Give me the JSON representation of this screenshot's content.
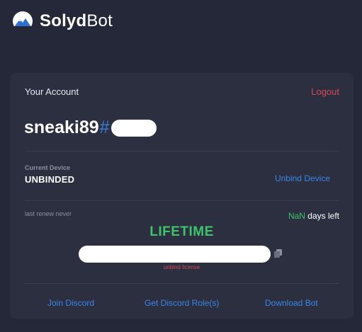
{
  "header": {
    "brand_bold": "Solyd",
    "brand_regular": "Bot",
    "logo_icon": "mountain-logo-icon"
  },
  "account": {
    "label": "Your Account",
    "logout": "Logout",
    "username": "sneaki89",
    "discriminator_prefix": "#"
  },
  "device": {
    "label": "Current Device",
    "value": "UNBINDED",
    "unbind": "Unbind Device"
  },
  "license": {
    "last_renew": "last renew never",
    "days_value": "NaN",
    "days_suffix": "days left",
    "type": "LIFETIME",
    "unbind": "unbind license",
    "copy_icon": "copy-icon"
  },
  "footer": {
    "join_discord": "Join Discord",
    "get_role": "Get Discord Role(s)",
    "download": "Download Bot"
  },
  "colors": {
    "background": "#242838",
    "card": "#2b2f3f",
    "accent_blue": "#3d86e6",
    "accent_green": "#3ec46d",
    "accent_red": "#d44a55"
  }
}
